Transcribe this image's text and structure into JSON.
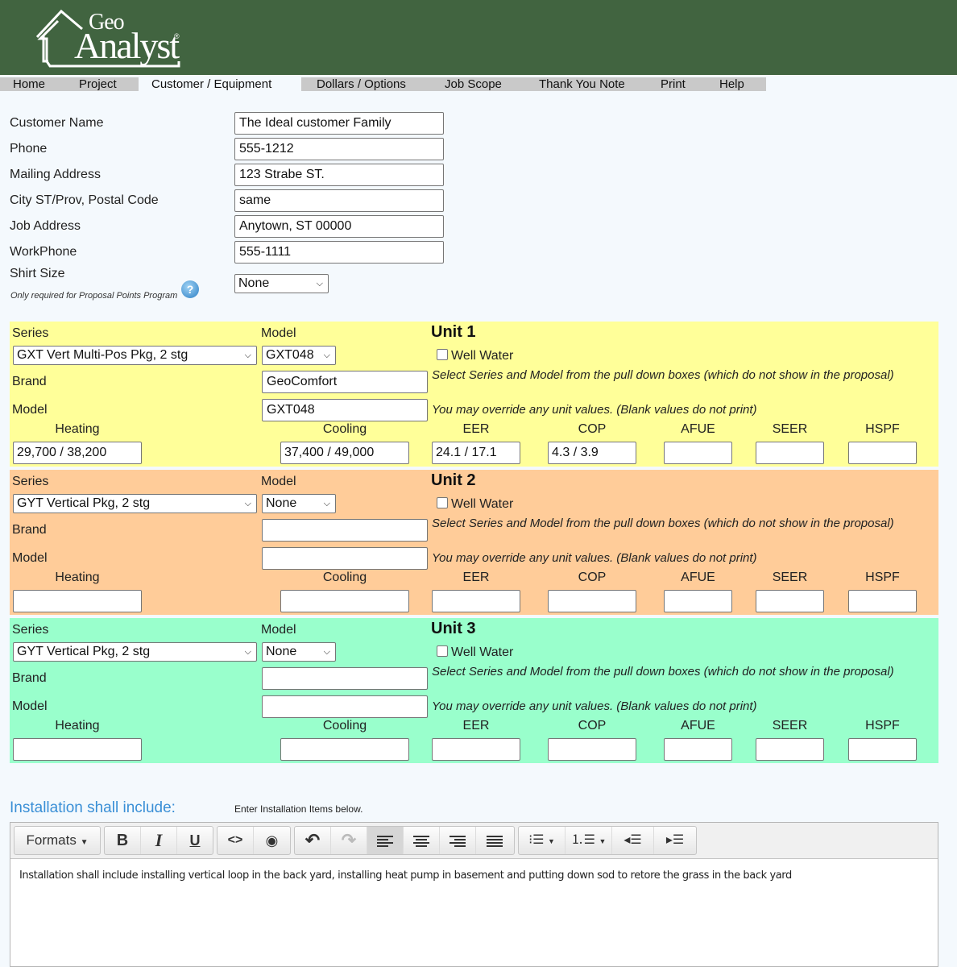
{
  "app": {
    "logo_top": "Geo",
    "logo_bottom": "Analyst",
    "logo_reg": "®"
  },
  "nav": {
    "items": [
      {
        "label": "Home"
      },
      {
        "label": "Project"
      },
      {
        "label": "Customer / Equipment",
        "active": true
      },
      {
        "label": "Dollars / Options"
      },
      {
        "label": "Job Scope"
      },
      {
        "label": "Thank You Note"
      },
      {
        "label": "Print"
      },
      {
        "label": "Help"
      }
    ]
  },
  "customer": {
    "fields": [
      {
        "label": "Customer Name",
        "value": "The Ideal customer Family"
      },
      {
        "label": "Phone",
        "value": "555-1212"
      },
      {
        "label": "Mailing Address",
        "value": "123 Strabe ST."
      },
      {
        "label": "City ST/Prov, Postal Code",
        "value": "same"
      },
      {
        "label": "Job Address",
        "value": "Anytown, ST 00000"
      },
      {
        "label": "WorkPhone",
        "value": "555-1111"
      }
    ],
    "shirt_size": {
      "label": "Shirt Size",
      "note": "Only required for Proposal Points Program",
      "value": "None",
      "help_icon": "question-mark"
    }
  },
  "unit_labels": {
    "series": "Series",
    "model": "Model",
    "brand": "Brand",
    "model_text": "Model",
    "well_water": "Well Water",
    "note1": "Select Series and Model from the pull down boxes (which do not show in the proposal)",
    "note2": "You may override any unit values. (Blank values do not print)",
    "heating": "Heating",
    "cooling": "Cooling",
    "eer": "EER",
    "cop": "COP",
    "afue": "AFUE",
    "seer": "SEER",
    "hspf": "HSPF"
  },
  "units": [
    {
      "title": "Unit 1",
      "color": "#ffff99",
      "series": "GXT Vert Multi-Pos Pkg, 2 stg",
      "model_select": "GXT048",
      "well_water": false,
      "brand": "GeoComfort",
      "model": "GXT048",
      "heating": "29,700 / 38,200",
      "cooling": "37,400 / 49,000",
      "eer": "24.1 / 17.1",
      "cop": "4.3 / 3.9",
      "afue": "",
      "seer": "",
      "hspf": ""
    },
    {
      "title": "Unit 2",
      "color": "#ffcc99",
      "series": "GYT Vertical Pkg, 2 stg",
      "model_select": "None",
      "well_water": false,
      "brand": "",
      "model": "",
      "heating": "",
      "cooling": "",
      "eer": "",
      "cop": "",
      "afue": "",
      "seer": "",
      "hspf": ""
    },
    {
      "title": "Unit 3",
      "color": "#99ffcc",
      "series": "GYT Vertical Pkg, 2 stg",
      "model_select": "None",
      "well_water": false,
      "brand": "",
      "model": "",
      "heating": "",
      "cooling": "",
      "eer": "",
      "cop": "",
      "afue": "",
      "seer": "",
      "hspf": ""
    }
  ],
  "installation": {
    "title": "Installation shall include:",
    "hint": "Enter Installation Items below.",
    "toolbar": {
      "formats_label": "Formats",
      "bold": "B",
      "italic": "I",
      "underline": "U",
      "code": "<>",
      "preview": "👁",
      "undo": "↶",
      "redo": "↷"
    },
    "content": "Installation shall include installing vertical loop in the back yard, installing heat pump in basement and putting down sod to retore the grass in the back yard"
  }
}
